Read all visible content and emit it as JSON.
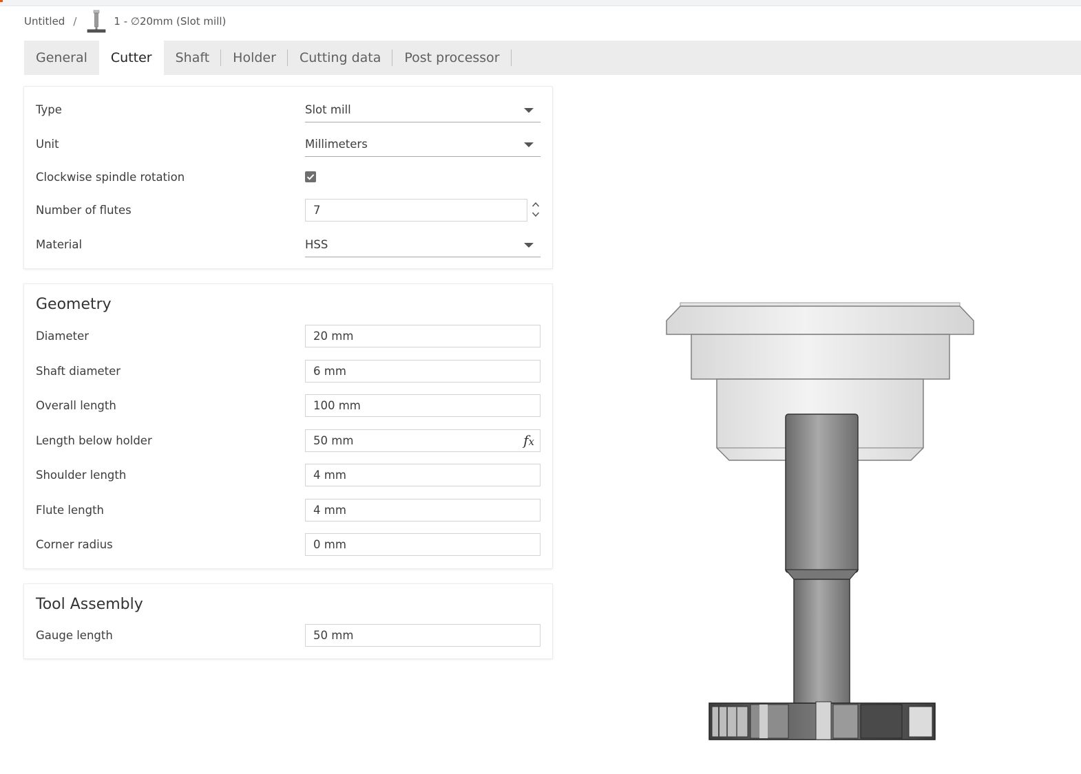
{
  "breadcrumb": {
    "root": "Untitled",
    "separator": "/",
    "tool_icon": "slot-mill-tool-icon",
    "tool_name": "1 - ∅20mm (Slot mill)"
  },
  "tabs": [
    {
      "label": "General"
    },
    {
      "label": "Cutter",
      "active": true
    },
    {
      "label": "Shaft"
    },
    {
      "label": "Holder"
    },
    {
      "label": "Cutting data"
    },
    {
      "label": "Post processor"
    }
  ],
  "cutter": {
    "type": {
      "label": "Type",
      "value": "Slot mill"
    },
    "unit": {
      "label": "Unit",
      "value": "Millimeters"
    },
    "clockwise": {
      "label": "Clockwise spindle rotation",
      "checked": true
    },
    "flutes": {
      "label": "Number of flutes",
      "value": "7"
    },
    "material": {
      "label": "Material",
      "value": "HSS"
    }
  },
  "geometry": {
    "title": "Geometry",
    "diameter": {
      "label": "Diameter",
      "value": "20 mm"
    },
    "shaft_diameter": {
      "label": "Shaft diameter",
      "value": "6 mm"
    },
    "overall_length": {
      "label": "Overall length",
      "value": "100 mm"
    },
    "length_below_holder": {
      "label": "Length below holder",
      "value": "50 mm",
      "fx_icon": "formula-fx-icon"
    },
    "shoulder_length": {
      "label": "Shoulder length",
      "value": "4 mm"
    },
    "flute_length": {
      "label": "Flute length",
      "value": "4 mm"
    },
    "corner_radius": {
      "label": "Corner radius",
      "value": "0 mm"
    }
  },
  "tool_assembly": {
    "title": "Tool Assembly",
    "gauge_length": {
      "label": "Gauge length",
      "value": "50 mm"
    }
  },
  "colors": {
    "accent": "#d75a1e",
    "tab_bar": "#ececec",
    "checkbox": "#6e6e6e"
  }
}
